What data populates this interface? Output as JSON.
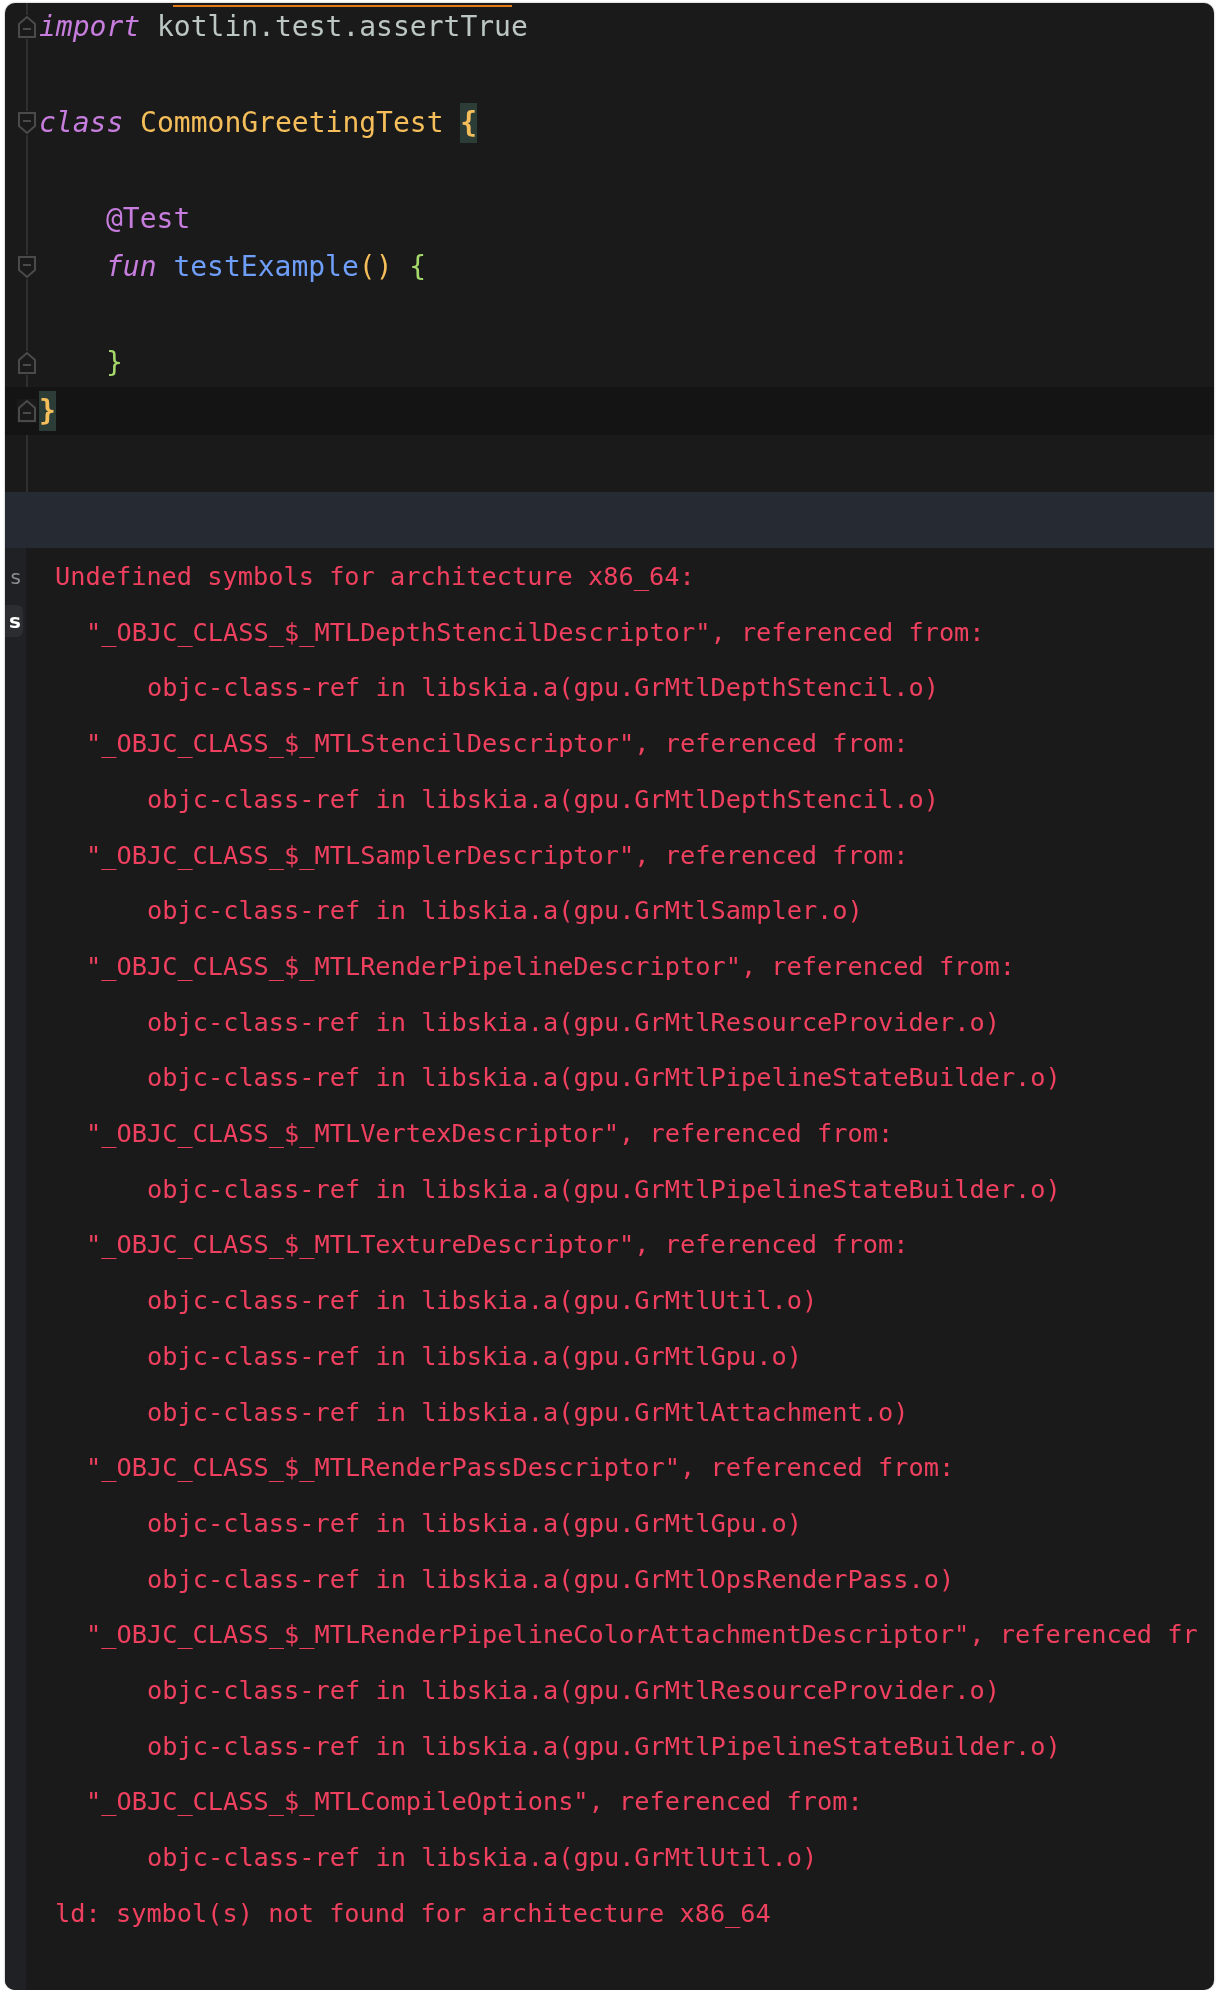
{
  "editor": {
    "lines": [
      {
        "fold_end": true,
        "current": false,
        "tokens": [
          {
            "text": "import",
            "kind": "keyword"
          },
          {
            "text": "kotlin.test.assertTrue",
            "kind": "plain",
            "warning": true
          }
        ]
      },
      {
        "current": false
      },
      {
        "fold_start": true,
        "current": false,
        "tokens": [
          {
            "text": "class",
            "kind": "keyword"
          },
          {
            "text": "CommonGreetingTest",
            "kind": "class"
          },
          {
            "text": "{",
            "kind": "brace",
            "matched": true
          }
        ]
      },
      {
        "current": false
      },
      {
        "indented": true,
        "current": false,
        "tokens": [
          {
            "text": "@Test",
            "kind": "annotation"
          }
        ]
      },
      {
        "fold_start": true,
        "indented": true,
        "current": false,
        "tokens": [
          {
            "text": "fun",
            "kind": "keyword"
          },
          {
            "text": "testExample",
            "kind": "function"
          },
          {
            "text": "()",
            "kind": "paren",
            "joined": true
          },
          {
            "text": "{",
            "kind": "block"
          }
        ]
      },
      {
        "current": false
      },
      {
        "fold_end": true,
        "indented": true,
        "current": false,
        "tokens": [
          {
            "text": "}",
            "kind": "block"
          }
        ]
      },
      {
        "fold_end": true,
        "current": true,
        "tokens": [
          {
            "text": "}",
            "kind": "brace",
            "matched": true
          }
        ]
      }
    ]
  },
  "side_tabs": [
    {
      "label": "s",
      "selected": false
    },
    {
      "label": "s",
      "selected": true
    }
  ],
  "console": {
    "header": "Undefined symbols for architecture x86_64:",
    "symbols": [
      {
        "text": "\"_OBJC_CLASS_$_MTLDepthStencilDescriptor\", referenced from:",
        "refs": [
          "objc-class-ref in libskia.a(gpu.GrMtlDepthStencil.o)"
        ]
      },
      {
        "text": "\"_OBJC_CLASS_$_MTLStencilDescriptor\", referenced from:",
        "refs": [
          "objc-class-ref in libskia.a(gpu.GrMtlDepthStencil.o)"
        ]
      },
      {
        "text": "\"_OBJC_CLASS_$_MTLSamplerDescriptor\", referenced from:",
        "refs": [
          "objc-class-ref in libskia.a(gpu.GrMtlSampler.o)"
        ]
      },
      {
        "text": "\"_OBJC_CLASS_$_MTLRenderPipelineDescriptor\", referenced from:",
        "refs": [
          "objc-class-ref in libskia.a(gpu.GrMtlResourceProvider.o)",
          "objc-class-ref in libskia.a(gpu.GrMtlPipelineStateBuilder.o)"
        ]
      },
      {
        "text": "\"_OBJC_CLASS_$_MTLVertexDescriptor\", referenced from:",
        "refs": [
          "objc-class-ref in libskia.a(gpu.GrMtlPipelineStateBuilder.o)"
        ]
      },
      {
        "text": "\"_OBJC_CLASS_$_MTLTextureDescriptor\", referenced from:",
        "refs": [
          "objc-class-ref in libskia.a(gpu.GrMtlUtil.o)",
          "objc-class-ref in libskia.a(gpu.GrMtlGpu.o)",
          "objc-class-ref in libskia.a(gpu.GrMtlAttachment.o)"
        ]
      },
      {
        "text": "\"_OBJC_CLASS_$_MTLRenderPassDescriptor\", referenced from:",
        "refs": [
          "objc-class-ref in libskia.a(gpu.GrMtlGpu.o)",
          "objc-class-ref in libskia.a(gpu.GrMtlOpsRenderPass.o)"
        ]
      },
      {
        "text": "\"_OBJC_CLASS_$_MTLRenderPipelineColorAttachmentDescriptor\", referenced fr",
        "refs": [
          "objc-class-ref in libskia.a(gpu.GrMtlResourceProvider.o)",
          "objc-class-ref in libskia.a(gpu.GrMtlPipelineStateBuilder.o)"
        ]
      },
      {
        "text": "\"_OBJC_CLASS_$_MTLCompileOptions\", referenced from:",
        "refs": [
          "objc-class-ref in libskia.a(gpu.GrMtlUtil.o)"
        ]
      }
    ],
    "footer": "ld: symbol(s) not found for architecture x86_64"
  }
}
